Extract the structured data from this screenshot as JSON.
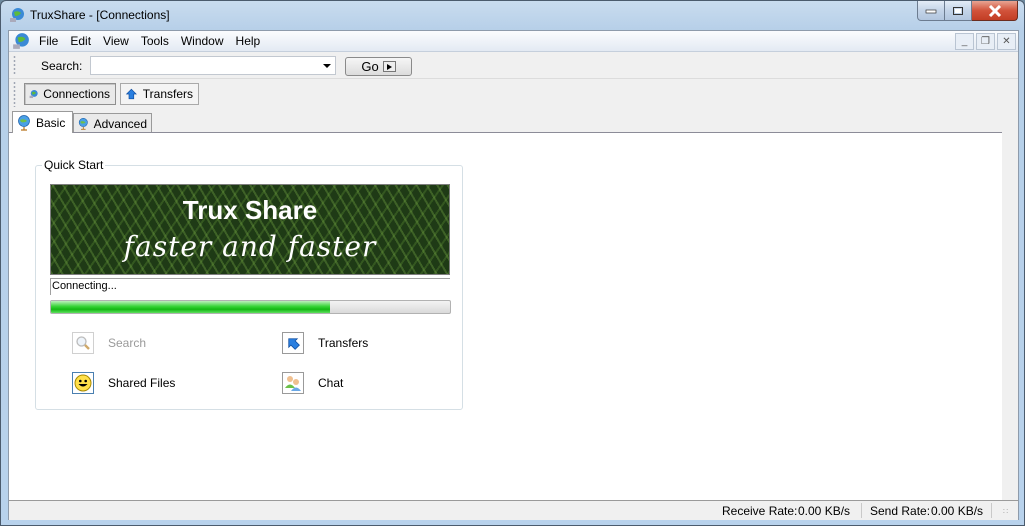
{
  "window": {
    "title": "TruxShare - [Connections]",
    "caption_buttons": [
      "minimize",
      "maximize",
      "close"
    ]
  },
  "menu": {
    "items": [
      "File",
      "Edit",
      "View",
      "Tools",
      "Window",
      "Help"
    ],
    "mdi_buttons": [
      "minimize",
      "restore",
      "close"
    ]
  },
  "search_toolbar": {
    "label": "Search:",
    "value": "",
    "placeholder": "",
    "go_label": "Go"
  },
  "view_toolbar": {
    "buttons": [
      {
        "label": "Connections",
        "icon": "globe-network-icon",
        "active": true
      },
      {
        "label": "Transfers",
        "icon": "transfer-arrow-icon",
        "active": false
      }
    ]
  },
  "tabs": [
    {
      "label": "Basic",
      "icon": "globe-icon",
      "active": true
    },
    {
      "label": "Advanced",
      "icon": "globe-icon",
      "active": false
    }
  ],
  "quick_start": {
    "title": "Quick Start",
    "banner_title": "Trux Share",
    "banner_subtitle": "faster and faster",
    "status": "Connecting...",
    "progress_percent": 70,
    "items": [
      {
        "label": "Search",
        "icon": "magnifier-icon",
        "enabled": false
      },
      {
        "label": "Transfers",
        "icon": "transfer-arrow-icon",
        "enabled": true
      },
      {
        "label": "Shared Files",
        "icon": "smiley-icon",
        "enabled": true
      },
      {
        "label": "Chat",
        "icon": "chat-users-icon",
        "enabled": true
      }
    ]
  },
  "statusbar": {
    "receive_label": "Receive Rate:",
    "receive_value": "0.00 KB/s",
    "send_label": "Send Rate:",
    "send_value": "0.00 KB/s"
  },
  "colors": {
    "progress_green": "#14b814",
    "close_red": "#c23d24"
  }
}
